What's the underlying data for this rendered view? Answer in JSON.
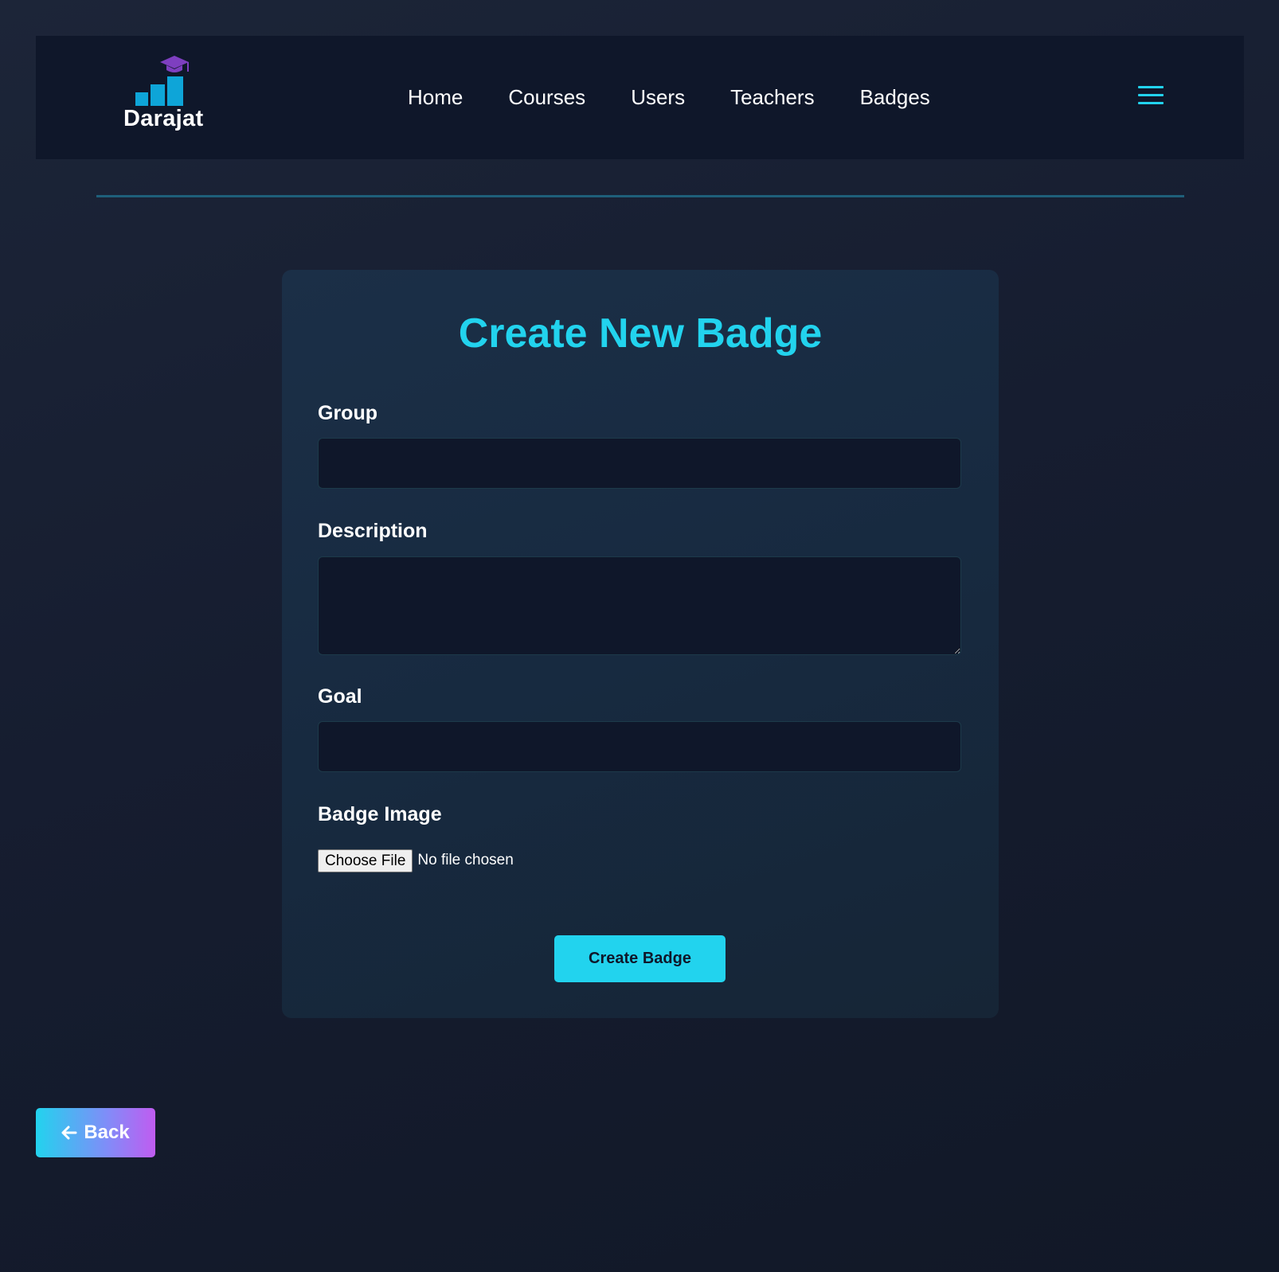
{
  "brand": {
    "name": "Darajat"
  },
  "nav": {
    "links": [
      {
        "label": "Home"
      },
      {
        "label": "Courses"
      },
      {
        "label": "Users"
      },
      {
        "label": "Teachers"
      },
      {
        "label": "Badges"
      }
    ],
    "menu_icon": "hamburger-icon"
  },
  "form": {
    "title": "Create New Badge",
    "fields": {
      "group": {
        "label": "Group",
        "value": "",
        "placeholder": ""
      },
      "description": {
        "label": "Description",
        "value": "",
        "placeholder": ""
      },
      "goal": {
        "label": "Goal",
        "value": "",
        "placeholder": ""
      },
      "badge_image": {
        "label": "Badge Image",
        "choose_label": "Choose File",
        "status": "No file chosen"
      }
    },
    "submit_label": "Create Badge"
  },
  "back": {
    "label": "Back",
    "icon": "arrow-left-icon"
  },
  "colors": {
    "accent": "#22d3ee",
    "nav_bg": "#0f172a",
    "logo_purple": "#7e3fc0",
    "logo_blue": "#0ea5d8"
  }
}
